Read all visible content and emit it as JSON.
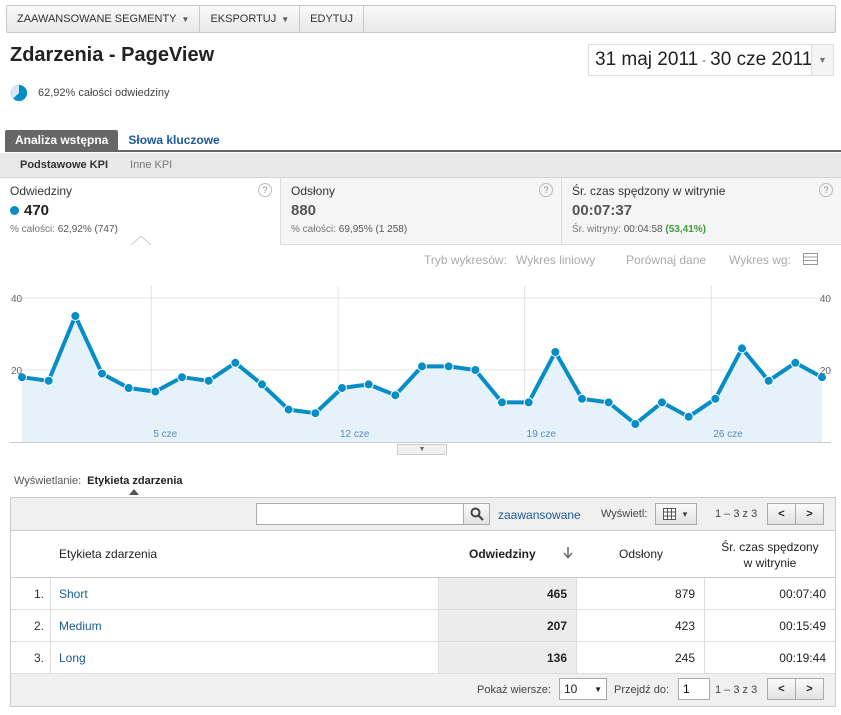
{
  "toolbar": {
    "segments_label": "ZAAWANSOWANE SEGMENTY",
    "export_label": "EKSPORTUJ",
    "edit_label": "EDYTUJ"
  },
  "header": {
    "title": "Zdarzenia - PageView",
    "date_start": "31 maj 2011",
    "date_sep": "-",
    "date_end": "30 cze 2011",
    "share_text": "62,92% całości odwiedziny",
    "share_fraction": 0.6292
  },
  "tabs": [
    {
      "label": "Analiza wstępna",
      "active": true
    },
    {
      "label": "Słowa kluczowe",
      "active": false
    }
  ],
  "subtabs": [
    {
      "label": "Podstawowe KPI",
      "active": true
    },
    {
      "label": "Inne KPI",
      "active": false
    }
  ],
  "kpis": [
    {
      "label": "Odwiedziny",
      "value": "470",
      "sub_prefix": "% całości:",
      "sub_value": "62,92% (747)",
      "sub_extra": ""
    },
    {
      "label": "Odsłony",
      "value": "880",
      "sub_prefix": "% całości:",
      "sub_value": "69,95% (1 258)",
      "sub_extra": ""
    },
    {
      "label": "Śr. czas spędzony w witrynie",
      "value": "00:07:37",
      "sub_prefix": "Śr. witryny:",
      "sub_value": "00:04:58",
      "sub_extra": "(53,41%)"
    }
  ],
  "chart_controls": {
    "mode_label": "Tryb wykresów:",
    "line_label": "Wykres liniowy",
    "compare_label": "Porównaj dane",
    "by_label": "Wykres wg:"
  },
  "chart_data": {
    "type": "area",
    "series": [
      {
        "name": "Odwiedziny",
        "values": [
          18,
          17,
          35,
          19,
          15,
          14,
          18,
          17,
          22,
          16,
          9,
          8,
          15,
          16,
          13,
          21,
          21,
          20,
          11,
          11,
          25,
          12,
          11,
          5,
          11,
          7,
          12,
          26,
          17,
          22,
          18
        ]
      }
    ],
    "x_tick_labels": [
      "5 cze",
      "12 cze",
      "19 cze",
      "26 cze"
    ],
    "x_tick_index": [
      5,
      12,
      19,
      26
    ],
    "y_ticks": [
      "40",
      "20"
    ],
    "y_tick_values": [
      40,
      20
    ],
    "ylim": [
      0,
      40
    ],
    "color": "#058dc7"
  },
  "viewing": {
    "label": "Wyświetlanie:",
    "selected": "Etykieta zdarzenia"
  },
  "table": {
    "search_placeholder": "",
    "advanced_label": "zaawansowane",
    "show_label": "Wyświetl:",
    "pager_text": "1 – 3 z 3",
    "columns": {
      "label": "Etykieta zdarzenia",
      "visits": "Odwiedziny",
      "pageviews": "Odsłony",
      "time_line1": "Śr. czas spędzony",
      "time_line2": "w witrynie"
    },
    "rows": [
      {
        "num": "1.",
        "label": "Short",
        "visits": "465",
        "pageviews": "879",
        "time": "00:07:40"
      },
      {
        "num": "2.",
        "label": "Medium",
        "visits": "207",
        "pageviews": "423",
        "time": "00:15:49"
      },
      {
        "num": "3.",
        "label": "Long",
        "visits": "136",
        "pageviews": "245",
        "time": "00:19:44"
      }
    ],
    "footer": {
      "rows_label": "Pokaż wiersze:",
      "rows_value": "10",
      "goto_label": "Przejdź do:",
      "goto_value": "1",
      "pager_text": "1 – 3 z 3"
    }
  }
}
